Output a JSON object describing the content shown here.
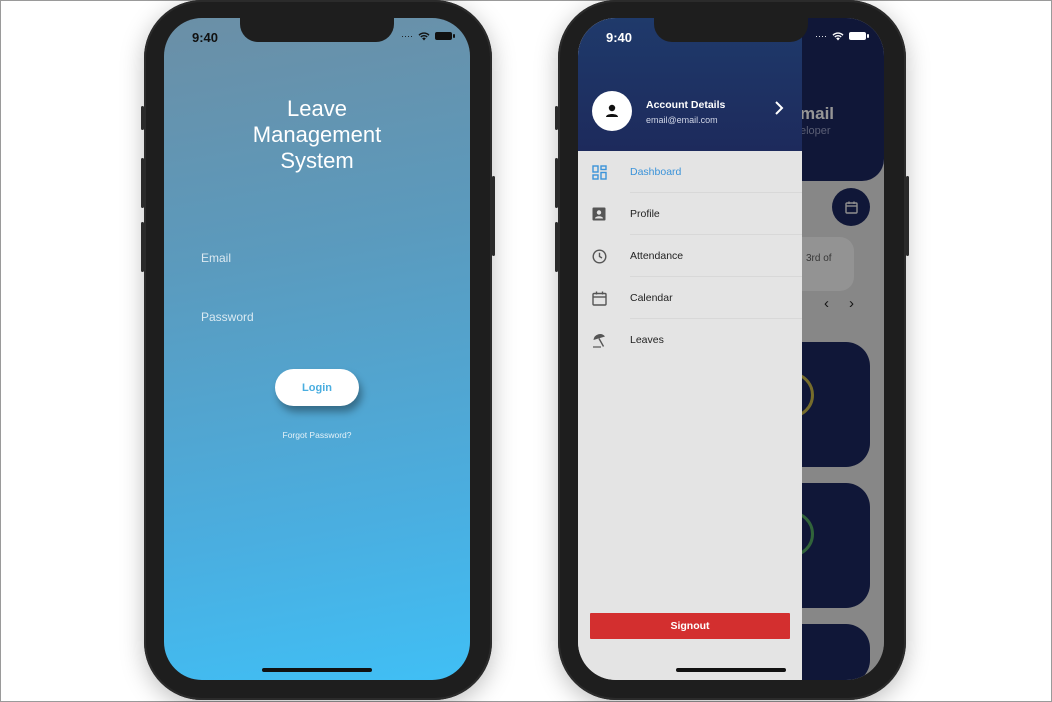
{
  "login": {
    "status_time": "9:40",
    "app_title": "Leave\nManagement\nSystem",
    "email_label": "Email",
    "password_label": "Password",
    "login_button": "Login",
    "forgot_password": "Forgot Password?"
  },
  "drawer_screen": {
    "status_time": "9:40",
    "account": {
      "title": "Account Details",
      "email": "email@email.com"
    },
    "menu": [
      {
        "label": "Dashboard",
        "icon": "dashboard-icon",
        "active": true
      },
      {
        "label": "Profile",
        "icon": "profile-icon",
        "active": false
      },
      {
        "label": "Attendance",
        "icon": "clock-icon",
        "active": false
      },
      {
        "label": "Calendar",
        "icon": "calendar-icon",
        "active": false
      },
      {
        "label": "Leaves",
        "icon": "beach-umbrella-icon",
        "active": false
      }
    ],
    "signout_button": "Signout",
    "background": {
      "name_fragment": "mail",
      "role_fragment": "eloper",
      "date_fragment": "3rd of",
      "prev": "‹",
      "next": "›"
    }
  },
  "colors": {
    "accent_blue": "#3b93d9",
    "navy": "#1a2456",
    "signout_red": "#d32f2f",
    "login_gradient_top": "#6b8fa6",
    "login_gradient_bottom": "#40bff5"
  }
}
